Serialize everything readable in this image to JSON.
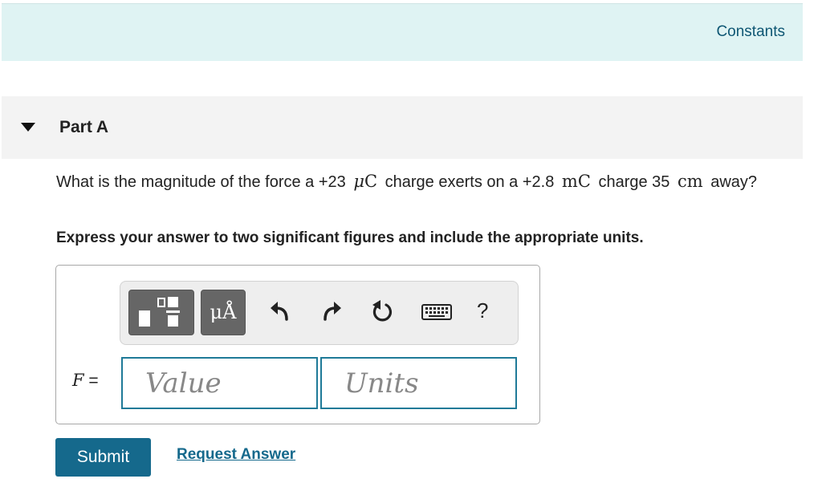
{
  "header": {
    "constants_label": "Constants"
  },
  "part": {
    "title": "Part A"
  },
  "question": {
    "text_1": "What is the magnitude of the force a +23",
    "unit_1_prefix": "μ",
    "unit_1_base": "C",
    "text_2": "charge exerts on a +2.8",
    "unit_2": "mC",
    "text_3": "charge 35",
    "unit_3": "cm",
    "text_4": "away?"
  },
  "instruction": "Express your answer to two significant figures and include the appropriate units.",
  "answer": {
    "variable": "F",
    "equals": "=",
    "value_placeholder": "Value",
    "units_placeholder": "Units"
  },
  "toolbar": {
    "units_button_label": "μÅ",
    "help_label": "?",
    "icons": [
      "templates-icon",
      "undo-icon",
      "redo-icon",
      "reset-icon",
      "keyboard-icon",
      "help-icon"
    ]
  },
  "actions": {
    "submit_label": "Submit",
    "request_label": "Request Answer"
  },
  "colors": {
    "header_bg": "#dff3f3",
    "accent": "#15698c",
    "input_border": "#1f7a98"
  }
}
